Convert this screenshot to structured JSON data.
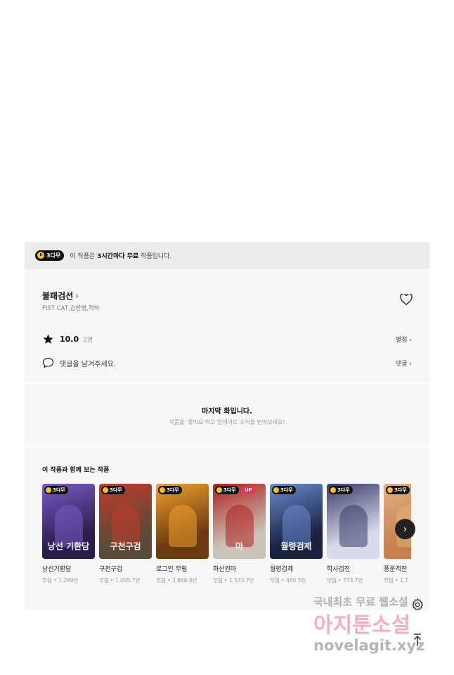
{
  "banner": {
    "badge_label": "3다무",
    "text_prefix": "이 작품은 ",
    "text_bold": "3시간마다 무료",
    "text_suffix": " 작품입니다."
  },
  "work": {
    "title": "불패검선",
    "authors": "FIST CAT,김찬영,적하",
    "rating": "10.0",
    "rating_count": "2명",
    "rating_link": "별점",
    "comment_prompt": "댓글을 남겨주세요.",
    "comment_link": "댓글"
  },
  "last_episode": {
    "title": "마지막 화입니다.",
    "subtitle": "작품을 '좋아요'하고 업데이트 소식을 받아보세요!"
  },
  "recommendations": {
    "heading": "이 작품과 함께 보는 작품",
    "items": [
      {
        "name": "낭선기환담",
        "meta": "무협 • 1,289만",
        "badge": "3다무",
        "cover_text": "낭선 기환담",
        "color": "#2b1d4a",
        "accent": "#7a5cc7"
      },
      {
        "name": "구천구검",
        "meta": "무협 • 1,005.7만",
        "badge": "3다무",
        "cover_text": "구천구검",
        "color": "#5a4a3a",
        "accent": "#c23a2a"
      },
      {
        "name": "로그인 무림",
        "meta": "무협 • 3,866.8만",
        "badge": "3다무",
        "cover_text": "",
        "color": "#6b3a10",
        "accent": "#f0a030"
      },
      {
        "name": "화산권마",
        "meta": "무협 • 1,533.7만",
        "badge": "3다무",
        "up": "UP",
        "cover_text": "마",
        "color": "#c9c3b8",
        "accent": "#b02020"
      },
      {
        "name": "월령검제",
        "meta": "무협 • 480.5만",
        "badge": "3다무",
        "cover_text": "월령검제",
        "color": "#1a2240",
        "accent": "#6a8bd0"
      },
      {
        "name": "학사검전",
        "meta": "무협 • 773.7만",
        "badge": "3다무",
        "cover_text": "",
        "color": "#d8dcea",
        "accent": "#3a3a6a"
      },
      {
        "name": "풍운객잔",
        "meta": "무협 • 1,7",
        "badge": "3다무",
        "cover_text": "",
        "color": "#c88050",
        "accent": "#e0b080"
      }
    ]
  },
  "watermark": {
    "line1": "국내최초 무료 웹소설",
    "line2": "아지툰소설",
    "line3": "novelagit.xyz"
  }
}
